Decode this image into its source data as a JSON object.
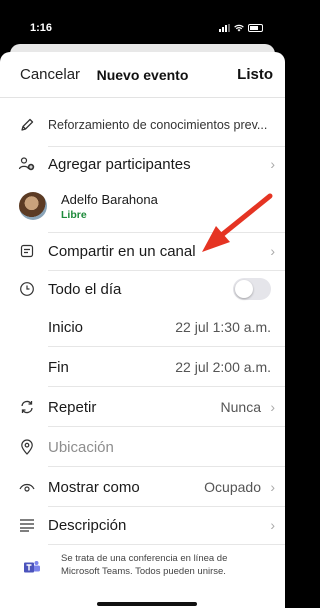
{
  "status": {
    "time": "1:16"
  },
  "nav": {
    "cancel": "Cancelar",
    "title": "Nuevo evento",
    "done": "Listo"
  },
  "form": {
    "title": "Reforzamiento de conocimientos prev...",
    "add_participants": "Agregar participantes",
    "participant": {
      "name": "Adelfo Barahona",
      "status": "Libre"
    },
    "share_channel": "Compartir en un canal",
    "all_day": "Todo el día",
    "start": {
      "label": "Inicio",
      "value": "22 jul 1:30 a.m."
    },
    "end": {
      "label": "Fin",
      "value": "22 jul 2:00 a.m."
    },
    "repeat": {
      "label": "Repetir",
      "value": "Nunca"
    },
    "location": "Ubicación",
    "show_as": {
      "label": "Mostrar como",
      "value": "Ocupado"
    },
    "description": "Descripción",
    "teams_note": "Se trata de una conferencia en línea de Microsoft Teams. Todos pueden unirse."
  },
  "colors": {
    "accent_arrow": "#e53423",
    "free_status": "#1d8a3a"
  }
}
